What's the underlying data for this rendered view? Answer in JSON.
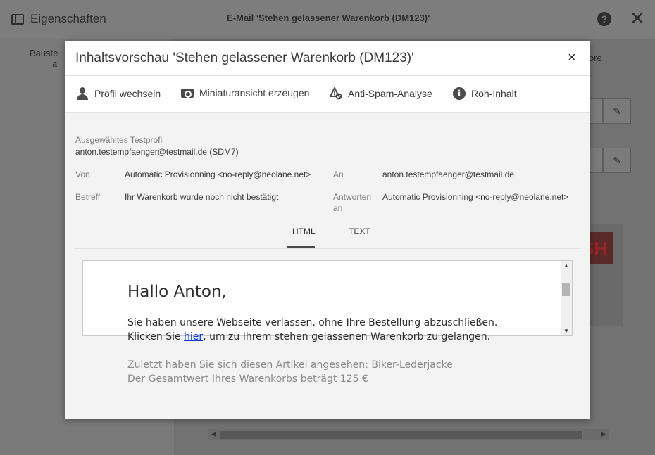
{
  "background": {
    "panel_title": "Eigenschaften",
    "window_title": "E-Mail 'Stehen gelassener Warenkorb (DM123)'",
    "help_glyph": "?",
    "close_glyph": "✕",
    "side_tab": "Bauste",
    "side_tab_line2": "a",
    "more_tab": "ore",
    "pen_glyph": "✎",
    "banner_text": "SH"
  },
  "modal": {
    "title": "Inhaltsvorschau 'Stehen gelassener Warenkorb (DM123)'",
    "close_glyph": "×",
    "toolbar": [
      {
        "label": "Profil wechseln",
        "icon": "user-icon"
      },
      {
        "label": "Miniaturansicht erzeugen",
        "icon": "camera-icon"
      },
      {
        "label": "Anti-Spam-Analyse",
        "icon": "anti-spam-icon"
      },
      {
        "label": "Roh-Inhalt",
        "icon": "info-icon"
      }
    ],
    "info_glyph": "i",
    "test_profile_label": "Ausgewähltes Testprofil",
    "test_profile_value": "anton.testempfaenger@testmail.de (SDM7)",
    "from_label": "Von",
    "from_value": "Automatic Provisionning <no-reply@neolane.net>",
    "to_label": "An",
    "to_value": "anton.testempfaenger@testmail.de",
    "subject_label": "Betreff",
    "subject_value": "Ihr Warenkorb wurde noch nicht bestätigt",
    "reply_label_line1": "Antworten",
    "reply_label_line2": "an",
    "reply_value": "Automatic Provisionning <no-reply@neolane.net>",
    "tabs": [
      "HTML",
      "TEXT"
    ],
    "active_tab": "HTML",
    "scroll_up_glyph": "▲",
    "scroll_down_glyph": "▼"
  },
  "email": {
    "greeting": "Hallo Anton,",
    "line1": "Sie haben unsere Webseite verlassen, ohne Ihre Bestellung abzuschließen.",
    "line2_prefix": "Klicken Sie ",
    "line2_link": "hier",
    "line2_suffix": ", um zu Ihrem stehen gelassenen Warenkorb zu gelangen.",
    "line3": "Zuletzt haben Sie sich diesen Artikel angesehen: Biker-Lederjacke",
    "line4": "Der Gesamtwert Ihres Warenkorbs beträgt 125 €"
  }
}
